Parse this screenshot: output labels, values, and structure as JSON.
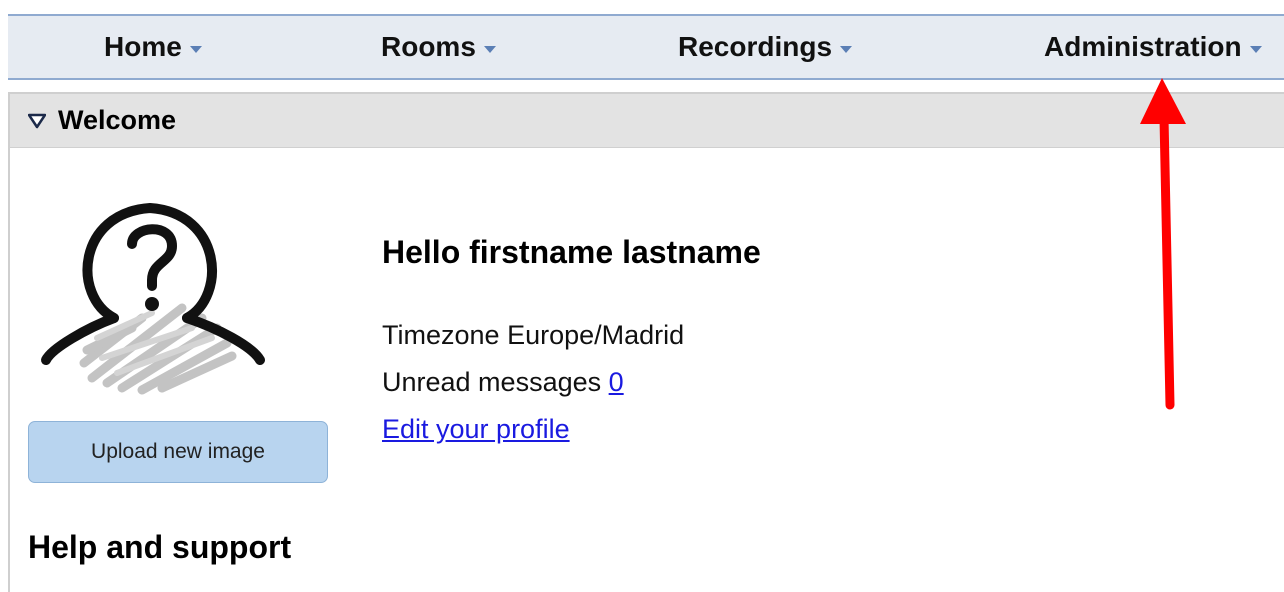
{
  "nav": {
    "items": [
      {
        "label": "Home"
      },
      {
        "label": "Rooms"
      },
      {
        "label": "Recordings"
      },
      {
        "label": "Administration"
      }
    ]
  },
  "welcome_panel": {
    "title": "Welcome",
    "upload_button_label": "Upload new image",
    "greeting": "Hello firstname lastname",
    "timezone_label": "Timezone",
    "timezone_value": "Europe/Madrid",
    "unread_label": "Unread messages",
    "unread_count": "0",
    "edit_profile_link": "Edit your profile",
    "help_title": "Help and support"
  },
  "icons": {
    "nav_caret": "chevron-down-icon",
    "panel_toggle": "triangle-down-icon",
    "avatar": "unknown-user-icon",
    "annotation": "red-arrow-icon"
  },
  "colors": {
    "navbar_bg": "#e6ebf2",
    "navbar_border": "#8faad0",
    "caret": "#5b7fb5",
    "panel_header_bg": "#e3e3e3",
    "button_bg": "#b8d4ef",
    "link": "#1a1ae0",
    "annotation_arrow": "#ff0000"
  }
}
